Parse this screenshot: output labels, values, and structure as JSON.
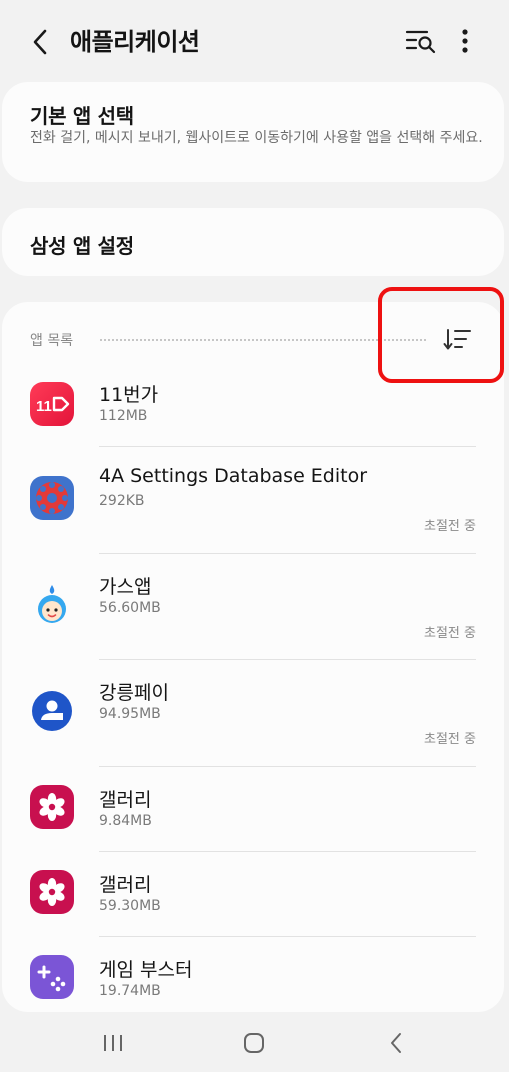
{
  "header": {
    "title": "애플리케이션",
    "back_icon": "chevron-left-icon",
    "search_icon": "search-list-icon",
    "more_icon": "more-vertical-icon"
  },
  "default_apps": {
    "title": "기본 앱 선택",
    "description": "전화 걸기, 메시지 보내기, 웹사이트로 이동하기에 사용할 앱을 선택해 주세요."
  },
  "samsung_settings": {
    "title": "삼성 앱 설정"
  },
  "app_list": {
    "header": "앱 목록",
    "sort_icon": "sort-icon",
    "apps": [
      {
        "name": "11번가",
        "size": "112MB",
        "status": "",
        "icon": "11st-icon"
      },
      {
        "name": "4A Settings Database Editor",
        "size": "292KB",
        "status": "초절전 중",
        "icon": "database-editor-icon"
      },
      {
        "name": "가스앱",
        "size": "56.60MB",
        "status": "초절전 중",
        "icon": "gasapp-icon"
      },
      {
        "name": "강릉페이",
        "size": "94.95MB",
        "status": "초절전 중",
        "icon": "gangneung-pay-icon"
      },
      {
        "name": "갤러리",
        "size": "9.84MB",
        "status": "",
        "icon": "gallery-icon"
      },
      {
        "name": "갤러리",
        "size": "59.30MB",
        "status": "",
        "icon": "gallery-icon"
      },
      {
        "name": "게임 부스터",
        "size": "19.74MB",
        "status": "",
        "icon": "game-booster-icon"
      }
    ]
  },
  "navbar": {
    "recents_icon": "recents-icon",
    "home_icon": "home-icon",
    "back_icon": "back-icon"
  },
  "colors": {
    "background": "#f2f2f2",
    "card": "#fcfcfc",
    "highlight": "#ee1111",
    "eleven_red": "#f2274a",
    "gallery_pink": "#c8104f",
    "booster_purple": "#7b55d6",
    "pay_blue": "#1f55c8"
  }
}
